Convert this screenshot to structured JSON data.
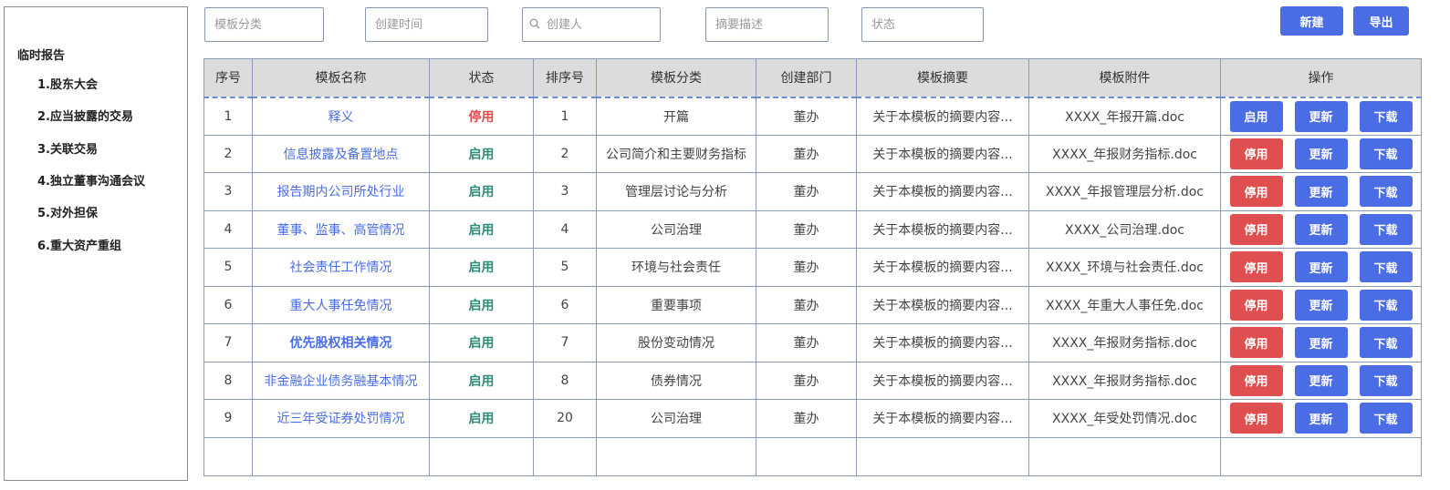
{
  "sidebar": {
    "title": "临时报告",
    "items": [
      {
        "label": "1.股东大会"
      },
      {
        "label": "2.应当披露的交易"
      },
      {
        "label": "3.关联交易"
      },
      {
        "label": "4.独立董事沟通会议"
      },
      {
        "label": "5.对外担保"
      },
      {
        "label": "6.重大资产重组"
      }
    ]
  },
  "filters": {
    "category_placeholder": "模板分类",
    "created_time_placeholder": "创建时间",
    "creator_placeholder": "创建人",
    "summary_placeholder": "摘要描述",
    "status_placeholder": "状态"
  },
  "toolbar": {
    "new_label": "新建",
    "export_label": "导出"
  },
  "table": {
    "headers": [
      "序号",
      "模板名称",
      "状态",
      "排序号",
      "模板分类",
      "创建部门",
      "模板摘要",
      "模板附件",
      "操作"
    ],
    "rows": [
      {
        "no": "1",
        "name": "释义",
        "status": "停用",
        "sort": "1",
        "category": "开篇",
        "dept": "董办",
        "summary": "关于本模板的摘要内容...",
        "attachment": "XXXX_年报开篇.doc",
        "toggle": "启用",
        "update": "更新",
        "download": "下载"
      },
      {
        "no": "2",
        "name": "信息披露及备置地点",
        "status": "启用",
        "sort": "2",
        "category": "公司简介和主要财务指标",
        "dept": "董办",
        "summary": "关于本模板的摘要内容...",
        "attachment": "XXXX_年报财务指标.doc",
        "toggle": "停用",
        "update": "更新",
        "download": "下载"
      },
      {
        "no": "3",
        "name": "报告期内公司所处行业",
        "status": "启用",
        "sort": "3",
        "category": "管理层讨论与分析",
        "dept": "董办",
        "summary": "关于本模板的摘要内容...",
        "attachment": "XXXX_年报管理层分析.doc",
        "toggle": "停用",
        "update": "更新",
        "download": "下载"
      },
      {
        "no": "4",
        "name": "董事、监事、高管情况",
        "status": "启用",
        "sort": "4",
        "category": "公司治理",
        "dept": "董办",
        "summary": "关于本模板的摘要内容...",
        "attachment": "XXXX_公司治理.doc",
        "toggle": "停用",
        "update": "更新",
        "download": "下载"
      },
      {
        "no": "5",
        "name": "社会责任工作情况",
        "status": "启用",
        "sort": "5",
        "category": "环境与社会责任",
        "dept": "董办",
        "summary": "关于本模板的摘要内容...",
        "attachment": "XXXX_环境与社会责任.doc",
        "toggle": "停用",
        "update": "更新",
        "download": "下载"
      },
      {
        "no": "6",
        "name": "重大人事任免情况",
        "status": "启用",
        "sort": "6",
        "category": "重要事项",
        "dept": "董办",
        "summary": "关于本模板的摘要内容...",
        "attachment": "XXXX_年重大人事任免.doc",
        "toggle": "停用",
        "update": "更新",
        "download": "下载"
      },
      {
        "no": "7",
        "name": "优先股权相关情况",
        "status": "启用",
        "sort": "7",
        "category": "股份变动情况",
        "dept": "董办",
        "summary": "关于本模板的摘要内容...",
        "attachment": "XXXX_年报财务指标.doc",
        "toggle": "停用",
        "update": "更新",
        "download": "下载"
      },
      {
        "no": "8",
        "name": "非金融企业债务融基本情况",
        "status": "启用",
        "sort": "8",
        "category": "债券情况",
        "dept": "董办",
        "summary": "关于本模板的摘要内容...",
        "attachment": "XXXX_年报财务指标.doc",
        "toggle": "停用",
        "update": "更新",
        "download": "下载"
      },
      {
        "no": "9",
        "name": "近三年受证券处罚情况",
        "status": "启用",
        "sort": "20",
        "category": "公司治理",
        "dept": "董办",
        "summary": "关于本模板的摘要内容...",
        "attachment": "XXXX_年受处罚情况.doc",
        "toggle": "停用",
        "update": "更新",
        "download": "下载"
      }
    ]
  },
  "colors": {
    "primary_blue": "#4a6de5",
    "danger_red": "#e04f4f",
    "enabled_green": "#2e8b7a",
    "disabled_red": "#e04b4b",
    "header_gray": "#dcdcdc"
  },
  "icons": {
    "search": "search-icon"
  }
}
